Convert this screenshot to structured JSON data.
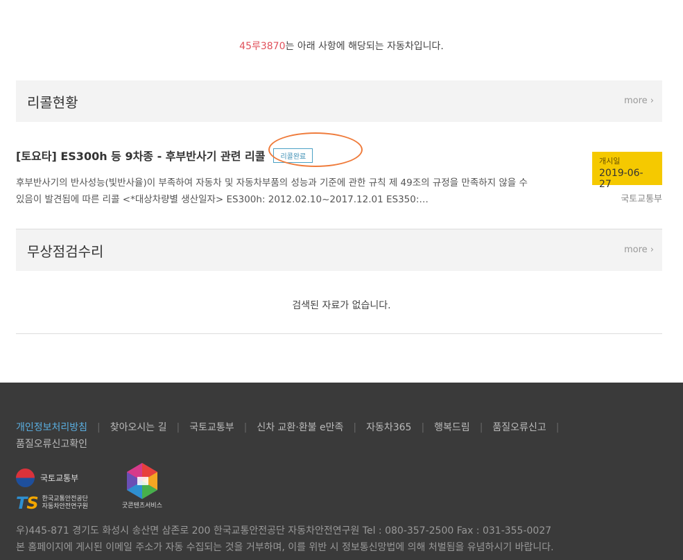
{
  "intro": {
    "plate": "45루3870",
    "text": "는 아래 사항에 해당되는 자동차입니다."
  },
  "recall_section": {
    "title": "리콜현황",
    "more": "more ›",
    "item": {
      "title": "[토요타] ES300h 등 9차종 - 후부반사기 관련 리콜",
      "status_badge": "리콜완료",
      "description": "후부반사기의 반사성능(빛반사율)이 부족하여 자동차 및 자동차부품의 성능과 기준에 관한 규칙 제 49조의 규정을 만족하지 않을 수 있음이 발견됨에 따른 리콜 <*대상차량별 생산일자> ES300h: 2012.02.10~2017.12.01 ES350:…",
      "start_label": "개시일",
      "start_date": "2019-06-27",
      "ministry": "국토교통부"
    }
  },
  "free_repair_section": {
    "title": "무상점검수리",
    "more": "more ›",
    "empty_message": "검색된 자료가 없습니다."
  },
  "footer": {
    "links": [
      "개인정보처리방침",
      "찾아오시는 길",
      "국토교통부",
      "신차 교환·환불 e만족",
      "자동차365",
      "행복드림",
      "품질오류신고",
      "품질오류신고확인"
    ],
    "logo_gov_text": "국토교통부",
    "logo_ts_mark": "TS",
    "logo_ts_line1": "한국교통안전공단",
    "logo_ts_line2": "자동차안전연구원",
    "logo_good_text": "굿콘텐츠서비스",
    "address": "우)445-871 경기도 화성시 송산면 삼존로 200 한국교통안전공단 자동차안전연구원 Tel : 080-357-2500 Fax : 031-355-0027",
    "notice": "본 홈페이지에 게시된 이메일 주소가 자동 수집되는 것을 거부하며, 이를 위반 시 정보통신망법에 의해 처벌됨을 유념하시기 바랍니다."
  },
  "colors": {
    "plate": "#e0505a",
    "badge": "#3d8fb5",
    "highlight_circle": "#ef7b3b",
    "date_box": "#f5c900",
    "footer_bg": "#3a3a3a",
    "footer_active_link": "#5aaee0"
  }
}
